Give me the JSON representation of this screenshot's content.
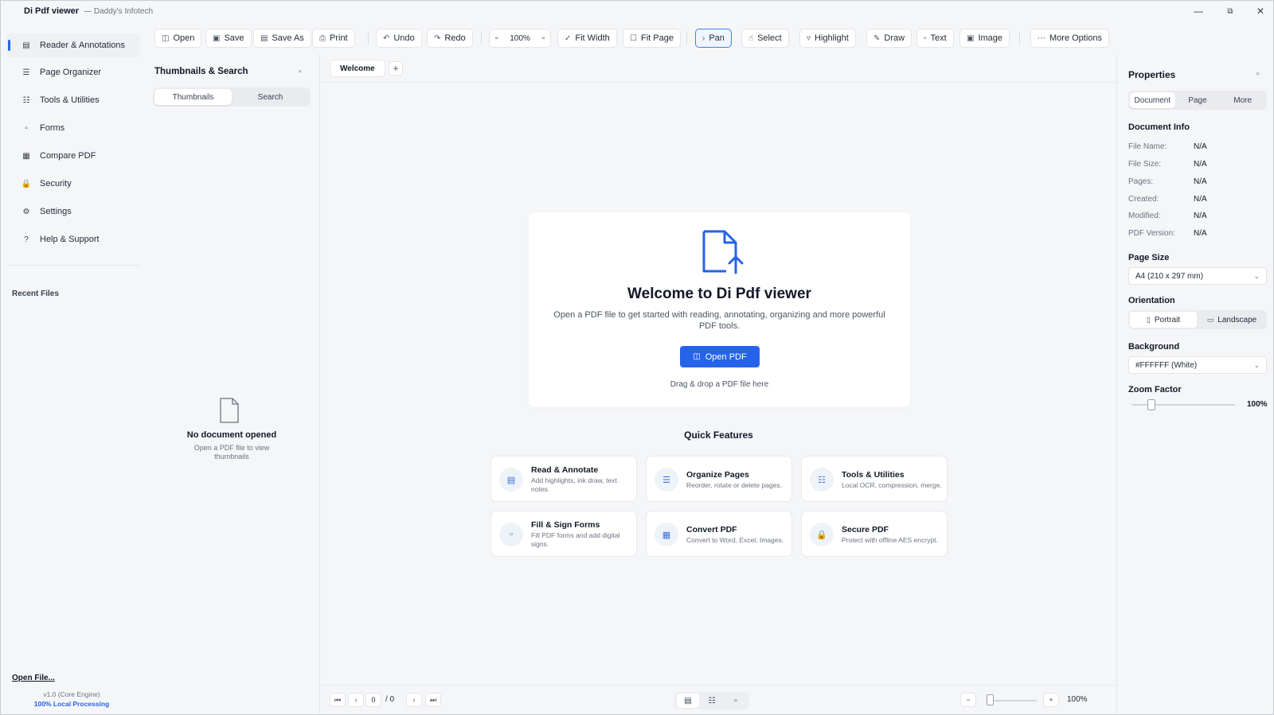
{
  "titlebar": {
    "app_name": "Di Pdf viewer",
    "company": "— Daddy's Infotech",
    "minimize_icon": "minimize-icon",
    "maximize_icon": "restore-icon",
    "close_icon": "close-icon"
  },
  "leftnav": {
    "items": [
      {
        "label": "Reader & Annotations",
        "icon": "book-icon",
        "active": true
      },
      {
        "label": "Page Organizer",
        "icon": "list-icon"
      },
      {
        "label": "Tools & Utilities",
        "icon": "tools-icon"
      },
      {
        "label": "Forms",
        "icon": "form-icon"
      },
      {
        "label": "Compare PDF",
        "icon": "compare-icon"
      },
      {
        "label": "Security",
        "icon": "lock-icon"
      },
      {
        "label": "Settings",
        "icon": "gear-icon"
      },
      {
        "label": "Help & Support",
        "icon": "help-icon"
      }
    ],
    "recent_title": "Recent Files",
    "open_file": "Open File...",
    "version": "v1.0 (Core Engine)",
    "local_processing": "100% Local Processing"
  },
  "toolbar": {
    "open": "Open",
    "save": "Save",
    "save_as": "Save As",
    "print": "Print",
    "undo": "Undo",
    "redo": "Redo",
    "zoom": "100%",
    "fit_width": "Fit Width",
    "fit_page": "Fit Page",
    "pan": "Pan",
    "select": "Select",
    "highlight": "Highlight",
    "draw": "Draw",
    "text": "Text",
    "image": "Image",
    "more_options": "More Options"
  },
  "thumbnails": {
    "title": "Thumbnails & Search",
    "tabs": [
      "Thumbnails",
      "Search"
    ],
    "empty_title": "No document opened",
    "empty_sub": "Open a PDF file to view thumbnails"
  },
  "tabs": {
    "welcome": "Welcome",
    "add": "+"
  },
  "welcome": {
    "title": "Welcome to Di Pdf viewer",
    "description": "Open a PDF file to get started with reading, annotating, organizing and more powerful PDF tools.",
    "open_button": "Open PDF",
    "drag_hint": "Drag & drop a PDF file here"
  },
  "quick_features": {
    "title": "Quick Features",
    "items": [
      {
        "title": "Read & Annotate",
        "desc": "Add highlights, ink draw, text notes.",
        "icon": "book-icon"
      },
      {
        "title": "Organize Pages",
        "desc": "Reorder, rotate or delete pages.",
        "icon": "list-icon"
      },
      {
        "title": "Tools & Utilities",
        "desc": "Local OCR, compression, merge.",
        "icon": "tools-icon"
      },
      {
        "title": "Fill & Sign Forms",
        "desc": "Fill PDF forms and add digital signs.",
        "icon": "form-icon"
      },
      {
        "title": "Convert PDF",
        "desc": "Convert to Word, Excel, Images.",
        "icon": "convert-icon"
      },
      {
        "title": "Secure PDF",
        "desc": "Protect with offline AES encrypt.",
        "icon": "lock-icon"
      }
    ]
  },
  "bottombar": {
    "page_current": "0",
    "page_total": "/ 0",
    "zoom": "100%",
    "zoom_level": 0.0
  },
  "properties": {
    "title": "Properties",
    "tabs": [
      "Document",
      "Page",
      "More"
    ],
    "doc_info_title": "Document Info",
    "doc_info": [
      {
        "key": "File Name:",
        "value": "N/A"
      },
      {
        "key": "File Size:",
        "value": "N/A"
      },
      {
        "key": "Pages:",
        "value": "N/A"
      },
      {
        "key": "Created:",
        "value": "N/A"
      },
      {
        "key": "Modified:",
        "value": "N/A"
      },
      {
        "key": "PDF Version:",
        "value": "N/A"
      }
    ],
    "page_size_title": "Page Size",
    "page_size": "A4 (210 x 297 mm)",
    "orientation_title": "Orientation",
    "orientation_options": [
      "Portrait",
      "Landscape"
    ],
    "background_title": "Background",
    "background": "#FFFFFF (White)",
    "zoom_factor_title": "Zoom Factor",
    "zoom_factor": "100%",
    "zoom_factor_level": 0.15
  },
  "colors": {
    "accent": "#2563eb",
    "background": "#f5f6f8"
  }
}
